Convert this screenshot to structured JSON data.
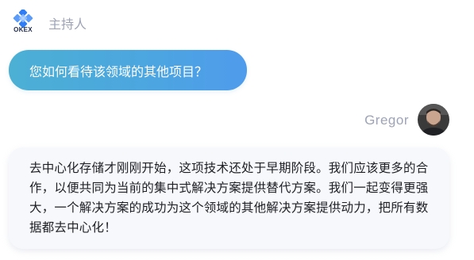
{
  "host": {
    "brand": "OKEX",
    "name": "主持人",
    "logo_icon": "okex-logo-icon"
  },
  "question": {
    "text": "您如何看待该领域的其他项目？"
  },
  "responder": {
    "name": "Gregor",
    "avatar_icon": "user-photo-icon"
  },
  "answer": {
    "text": "去中心化存储才刚刚开始，这项技术还处于早期阶段。我们应该更多的合作，以便共同为当前的集中式解决方案提供替代方案。我们一起变得更强大，一个解决方案的成功为这个领域的其他解决方案提供动力，把所有数据都去中心化！"
  },
  "colors": {
    "question_bubble_start": "#4cb0d4",
    "question_bubble_end": "#4f9bec",
    "answer_bubble_bg": "#f7f8fc",
    "label_gray": "#9ea4b6",
    "logo_blue": "#2f7df6"
  }
}
